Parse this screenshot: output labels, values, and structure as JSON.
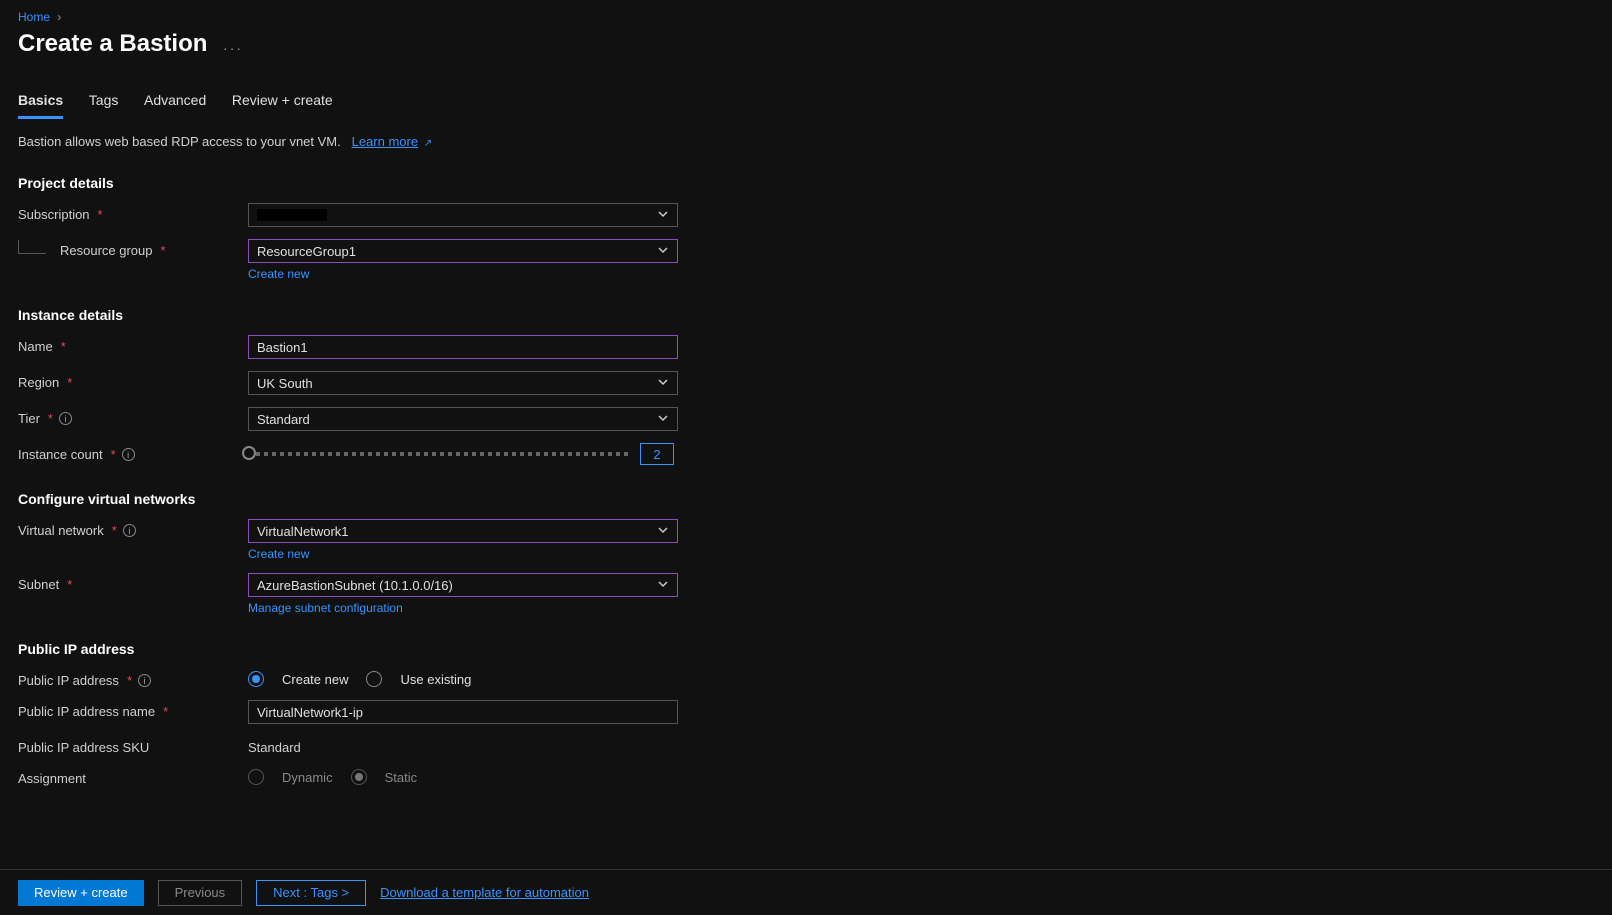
{
  "breadcrumb": {
    "home": "Home"
  },
  "title": "Create a Bastion",
  "tabs": [
    "Basics",
    "Tags",
    "Advanced",
    "Review + create"
  ],
  "active_tab": 0,
  "intro": {
    "text": "Bastion allows web based RDP access to your vnet VM.",
    "learn_more": "Learn more"
  },
  "sections": {
    "project": {
      "title": "Project details",
      "subscription": {
        "label": "Subscription",
        "value": ""
      },
      "resource_group": {
        "label": "Resource group",
        "value": "ResourceGroup1",
        "create_new": "Create new"
      }
    },
    "instance": {
      "title": "Instance details",
      "name": {
        "label": "Name",
        "value": "Bastion1"
      },
      "region": {
        "label": "Region",
        "value": "UK South"
      },
      "tier": {
        "label": "Tier",
        "value": "Standard"
      },
      "instance_count": {
        "label": "Instance count",
        "value": "2"
      }
    },
    "vnet": {
      "title": "Configure virtual networks",
      "virtual_network": {
        "label": "Virtual network",
        "value": "VirtualNetwork1",
        "create_new": "Create new"
      },
      "subnet": {
        "label": "Subnet",
        "value": "AzureBastionSubnet (10.1.0.0/16)",
        "manage": "Manage subnet configuration"
      }
    },
    "pip": {
      "title": "Public IP address",
      "mode": {
        "label": "Public IP address",
        "create_new": "Create new",
        "use_existing": "Use existing",
        "selected": "create_new"
      },
      "name": {
        "label": "Public IP address name",
        "value": "VirtualNetwork1-ip"
      },
      "sku": {
        "label": "Public IP address SKU",
        "value": "Standard"
      },
      "assignment": {
        "label": "Assignment",
        "dynamic": "Dynamic",
        "static": "Static",
        "selected": "static"
      }
    }
  },
  "footer": {
    "review": "Review + create",
    "previous": "Previous",
    "next": "Next : Tags >",
    "download": "Download a template for automation"
  }
}
